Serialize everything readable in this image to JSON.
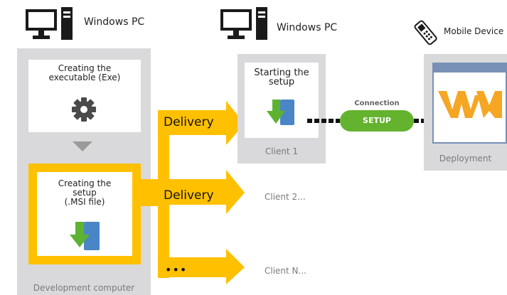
{
  "pc_left": {
    "label": "Windows PC",
    "icon": "desktop-pc-icon"
  },
  "pc_right": {
    "label": "Windows PC",
    "icon": "desktop-pc-icon"
  },
  "mobile": {
    "label": "Mobile Device",
    "icon": "handheld-scanner-icon"
  },
  "dev": {
    "exe_line1": "Creating the",
    "exe_line2": "executable (Exe)",
    "msi_line1": "Creating the",
    "msi_line2": "setup",
    "msi_line3": "(.MSI file)",
    "footer": "Development computer"
  },
  "client1": {
    "line1": "Starting the",
    "line2": "setup",
    "footer": "Client 1"
  },
  "clients": {
    "client2": "Client 2...",
    "clientn": "Client N..."
  },
  "delivery": {
    "label1": "Delivery",
    "label2": "Delivery",
    "label3": "•••"
  },
  "connection": {
    "title": "Connection",
    "pill": "SETUP"
  },
  "deployment": {
    "label": "Deployment",
    "logo": "wm-logo"
  },
  "colors": {
    "panel_gray": "#d9d9dc",
    "arrow_yellow": "#ffc000",
    "pill_green": "#63b32e",
    "logo_orange": "#f5a623",
    "arrow_green": "#5eb231",
    "arrow_blue": "#4a86c5",
    "window_blue": "#7890b6"
  }
}
